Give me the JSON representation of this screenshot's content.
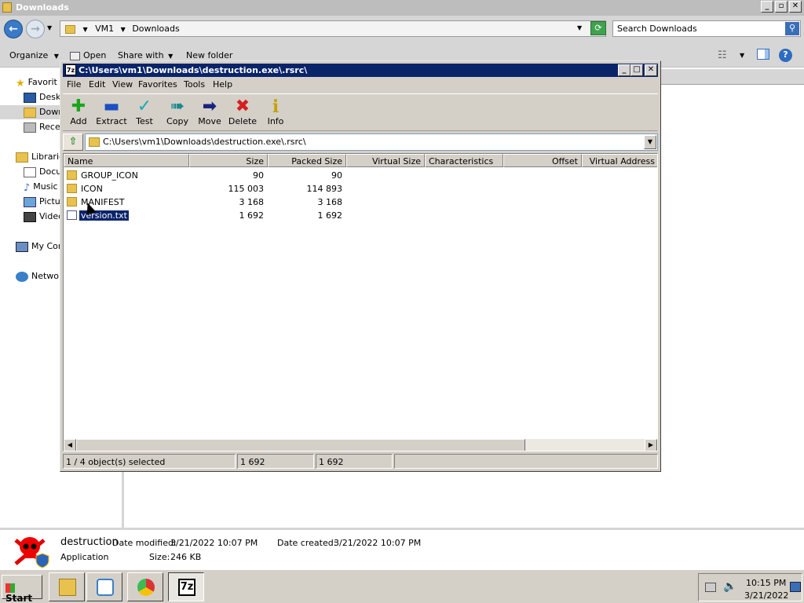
{
  "explorer": {
    "title": "Downloads",
    "breadcrumb": [
      "VM1",
      "Downloads"
    ],
    "search_placeholder": "Search Downloads",
    "toolbar": {
      "organize": "Organize",
      "open": "Open",
      "share_with": "Share with",
      "new_folder": "New folder"
    },
    "nav": {
      "favorites": "Favorit",
      "desktop": "Deskt",
      "downloads": "Down",
      "recent": "Rece",
      "libraries": "Librarie",
      "documents": "Docu",
      "music": "Music",
      "pictures": "Pictur",
      "videos": "Video",
      "computer": "My Com",
      "network": "Networ"
    },
    "details": {
      "name": "destruction",
      "type": "Application",
      "date_modified_label": "Date modified:",
      "date_modified": "3/21/2022 10:07 PM",
      "size_label": "Size:",
      "size": "246 KB",
      "date_created_label": "Date created:",
      "date_created": "3/21/2022 10:07 PM"
    }
  },
  "sevenzip": {
    "title": "C:\\Users\\vm1\\Downloads\\destruction.exe\\.rsrc\\",
    "menu": [
      "File",
      "Edit",
      "View",
      "Favorites",
      "Tools",
      "Help"
    ],
    "tools": [
      {
        "label": "Add",
        "icon": "plus-icon",
        "color": "#1fa31f"
      },
      {
        "label": "Extract",
        "icon": "minus-icon",
        "color": "#1a4ec2"
      },
      {
        "label": "Test",
        "icon": "check-icon",
        "color": "#1aa6b8"
      },
      {
        "label": "Copy",
        "icon": "double-arrow-icon",
        "color": "#1a8a8a"
      },
      {
        "label": "Move",
        "icon": "arrow-icon",
        "color": "#1a237e"
      },
      {
        "label": "Delete",
        "icon": "x-icon",
        "color": "#d42020"
      },
      {
        "label": "Info",
        "icon": "info-icon",
        "color": "#c8a000"
      }
    ],
    "path": "C:\\Users\\vm1\\Downloads\\destruction.exe\\.rsrc\\",
    "columns": [
      "Name",
      "Size",
      "Packed Size",
      "Virtual Size",
      "Characteristics",
      "Offset",
      "Virtual Address"
    ],
    "rows": [
      {
        "name": "GROUP_ICON",
        "size": "90",
        "packed": "90",
        "type": "folder"
      },
      {
        "name": "ICON",
        "size": "115 003",
        "packed": "114 893",
        "type": "folder"
      },
      {
        "name": "MANIFEST",
        "size": "3 168",
        "packed": "3 168",
        "type": "folder"
      },
      {
        "name": "version.txt",
        "size": "1 692",
        "packed": "1 692",
        "type": "file",
        "selected": true
      }
    ],
    "status": {
      "selection": "1 / 4 object(s) selected",
      "size": "1 692",
      "packed": "1 692"
    }
  },
  "taskbar": {
    "start": "Start",
    "clock_time": "10:15 PM",
    "clock_date": "3/21/2022"
  }
}
